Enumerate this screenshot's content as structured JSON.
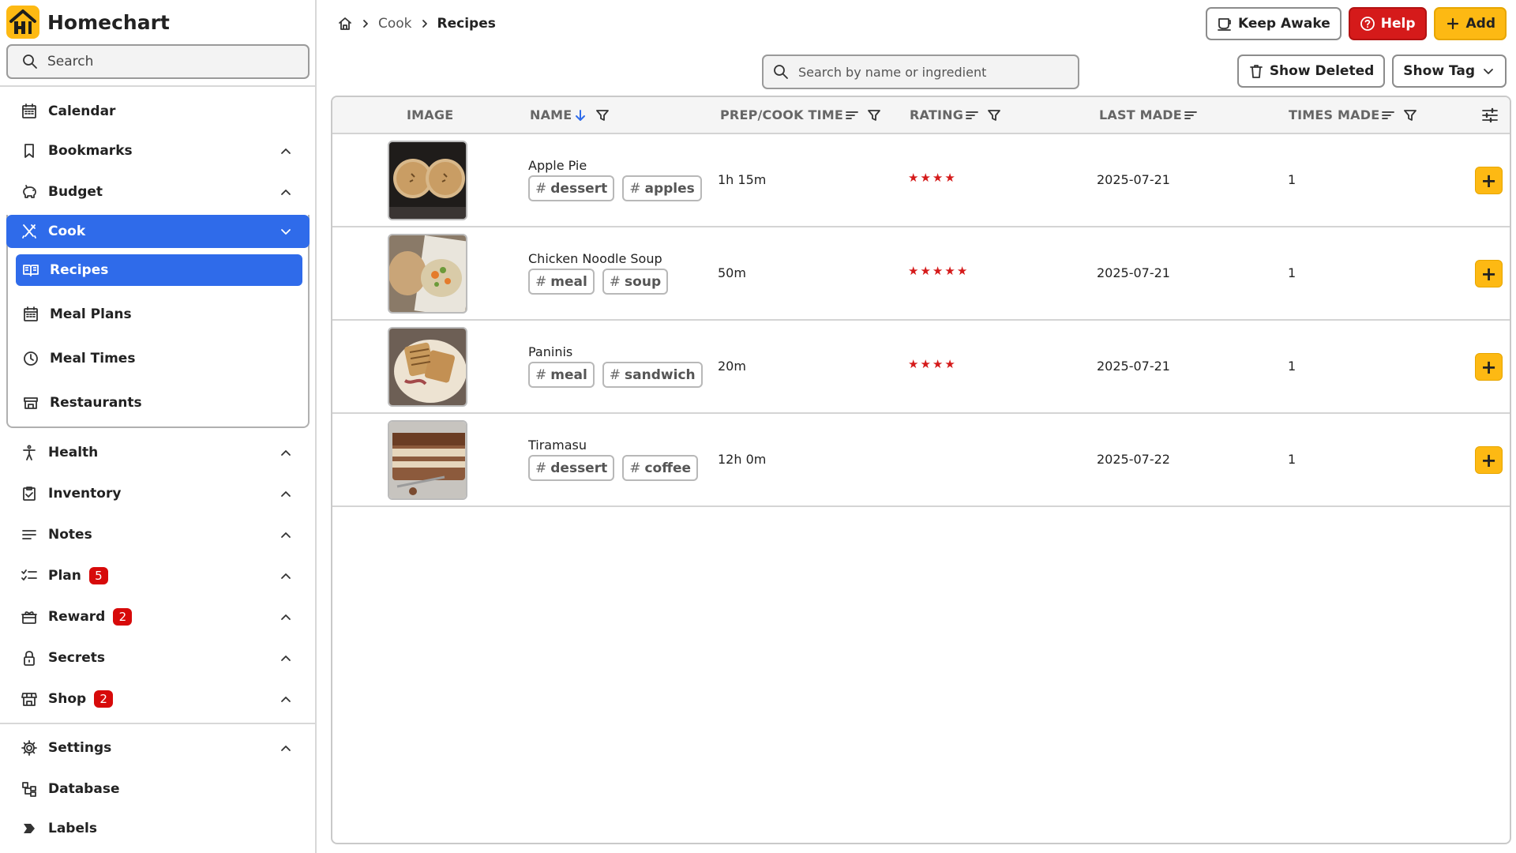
{
  "brand": {
    "name": "Homechart"
  },
  "sidebar": {
    "search_placeholder": "Search",
    "items": [
      {
        "label": "Calendar",
        "icon": "calendar-icon"
      },
      {
        "label": "Bookmarks",
        "icon": "bookmark-icon"
      },
      {
        "label": "Budget",
        "icon": "piggy-bank-icon"
      },
      {
        "label": "Cook",
        "icon": "utensils-icon"
      },
      {
        "label": "Health",
        "icon": "person-icon"
      },
      {
        "label": "Inventory",
        "icon": "inventory-icon"
      },
      {
        "label": "Notes",
        "icon": "notes-icon"
      },
      {
        "label": "Plan",
        "icon": "checklist-icon",
        "badge": "5"
      },
      {
        "label": "Reward",
        "icon": "gift-icon",
        "badge": "2"
      },
      {
        "label": "Secrets",
        "icon": "lock-icon"
      },
      {
        "label": "Shop",
        "icon": "store-icon",
        "badge": "2"
      },
      {
        "label": "Settings",
        "icon": "gear-icon"
      },
      {
        "label": "Database",
        "icon": "database-icon"
      },
      {
        "label": "Labels",
        "icon": "label-icon"
      }
    ],
    "cook_sub": [
      {
        "label": "Recipes",
        "icon": "book-icon"
      },
      {
        "label": "Meal Plans",
        "icon": "calendar-icon"
      },
      {
        "label": "Meal Times",
        "icon": "clock-icon"
      },
      {
        "label": "Restaurants",
        "icon": "store-icon"
      }
    ]
  },
  "breadcrumb": {
    "home_icon": "home-icon",
    "section": "Cook",
    "current": "Recipes"
  },
  "actions": {
    "keep_awake": "Keep Awake",
    "help": "Help",
    "add": "Add"
  },
  "search": {
    "placeholder": "Search by name or ingredient"
  },
  "tools": {
    "show_deleted": "Show Deleted",
    "show_tag": "Show Tag"
  },
  "table": {
    "headers": {
      "image": "IMAGE",
      "name": "NAME",
      "time": "PREP/COOK TIME",
      "rating": "RATING",
      "last_made": "LAST MADE",
      "times_made": "TIMES MADE"
    },
    "rows": [
      {
        "name": "Apple Pie",
        "tags": [
          "dessert",
          "apples"
        ],
        "time": "1h 15m",
        "rating": 4,
        "last_made": "2025-07-21",
        "times_made": "1",
        "image": "apple-pie-photo"
      },
      {
        "name": "Chicken Noodle Soup",
        "tags": [
          "meal",
          "soup"
        ],
        "time": "50m",
        "rating": 5,
        "last_made": "2025-07-21",
        "times_made": "1",
        "image": "soup-photo"
      },
      {
        "name": "Paninis",
        "tags": [
          "meal",
          "sandwich"
        ],
        "time": "20m",
        "rating": 4,
        "last_made": "2025-07-21",
        "times_made": "1",
        "image": "panini-photo"
      },
      {
        "name": "Tiramasu",
        "tags": [
          "dessert",
          "coffee"
        ],
        "time": "12h 0m",
        "rating": 0,
        "last_made": "2025-07-22",
        "times_made": "1",
        "image": "tiramisu-photo"
      }
    ]
  },
  "colors": {
    "accent": "#2f6bea",
    "help": "#d51a1a",
    "add": "#fdb913",
    "star": "#d51a1a"
  }
}
